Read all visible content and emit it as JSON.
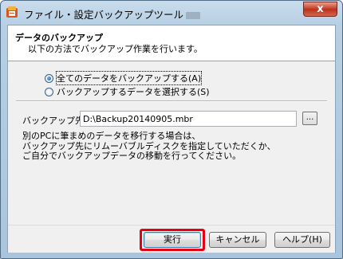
{
  "window": {
    "title": "ファイル・設定バックアップツール",
    "close_symbol": "x"
  },
  "header": {
    "title": "データのバックアップ",
    "subtitle": "以下の方法でバックアップ作業を行います。"
  },
  "options": [
    {
      "label": "全てのデータをバックアップする(A)",
      "checked": true
    },
    {
      "label": "バックアップするデータを選択する(S)",
      "checked": false
    }
  ],
  "destination": {
    "label": "バックアップ先(F)",
    "value": "D:\\Backup20140905.mbr",
    "browse_label": "..."
  },
  "note": {
    "lines": [
      "別のPCに筆まめのデータを移行する場合は、",
      "バックアップ先にリムーバブルディスクを指定していただくか、",
      "ご自分でバックアップデータの移動を行ってください。"
    ]
  },
  "buttons": {
    "execute": "実行",
    "cancel": "キャンセル",
    "help": "ヘルプ(H)"
  },
  "colors": {
    "highlight": "#e60012"
  }
}
